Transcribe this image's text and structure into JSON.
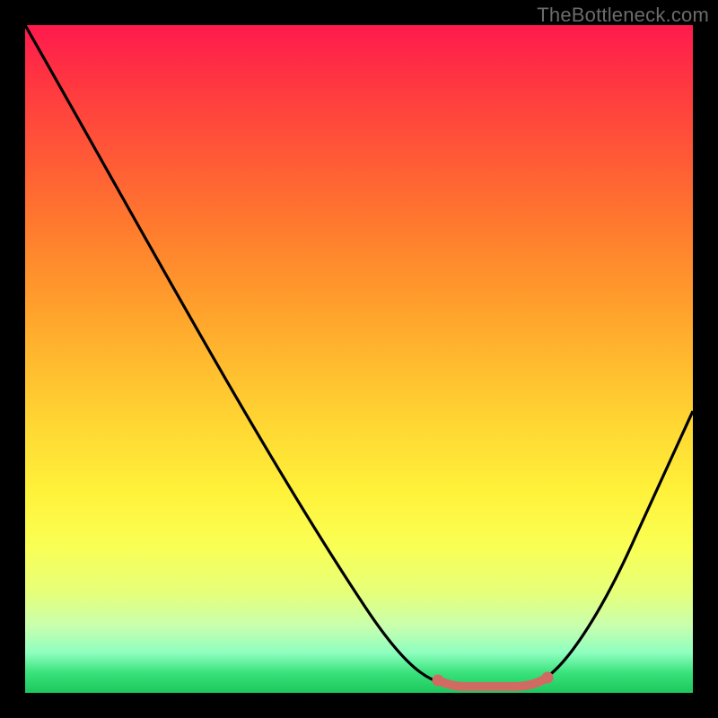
{
  "watermark": "TheBottleneck.com",
  "colors": {
    "stroke": "#000000",
    "highlight_stroke": "#d16a62",
    "highlight_fill": "#d16a62",
    "background_black": "#000000"
  },
  "chart_data": {
    "type": "line",
    "title": "",
    "xlabel": "",
    "ylabel": "",
    "xlim": [
      0,
      100
    ],
    "ylim": [
      0,
      100
    ],
    "grid": false,
    "legend": false,
    "note": "Values estimated from pixel geometry; axes have no visible tick labels.",
    "series": [
      {
        "name": "bottleneck-curve",
        "x": [
          0,
          5,
          10,
          15,
          20,
          25,
          30,
          35,
          40,
          45,
          50,
          55,
          60,
          65,
          68,
          70,
          72,
          74,
          76,
          78,
          80,
          85,
          90,
          95,
          100
        ],
        "y": [
          100,
          91,
          82,
          73,
          64,
          55,
          47,
          38,
          30,
          22,
          15,
          9,
          4,
          1,
          0,
          0,
          0,
          0,
          0,
          1,
          3,
          9,
          18,
          29,
          42
        ]
      }
    ],
    "highlight_segment": {
      "x": [
        62,
        65,
        68,
        70,
        72,
        74,
        76,
        78
      ],
      "y": [
        2,
        0.8,
        0.3,
        0.3,
        0.3,
        0.3,
        0.7,
        1.4
      ]
    }
  }
}
